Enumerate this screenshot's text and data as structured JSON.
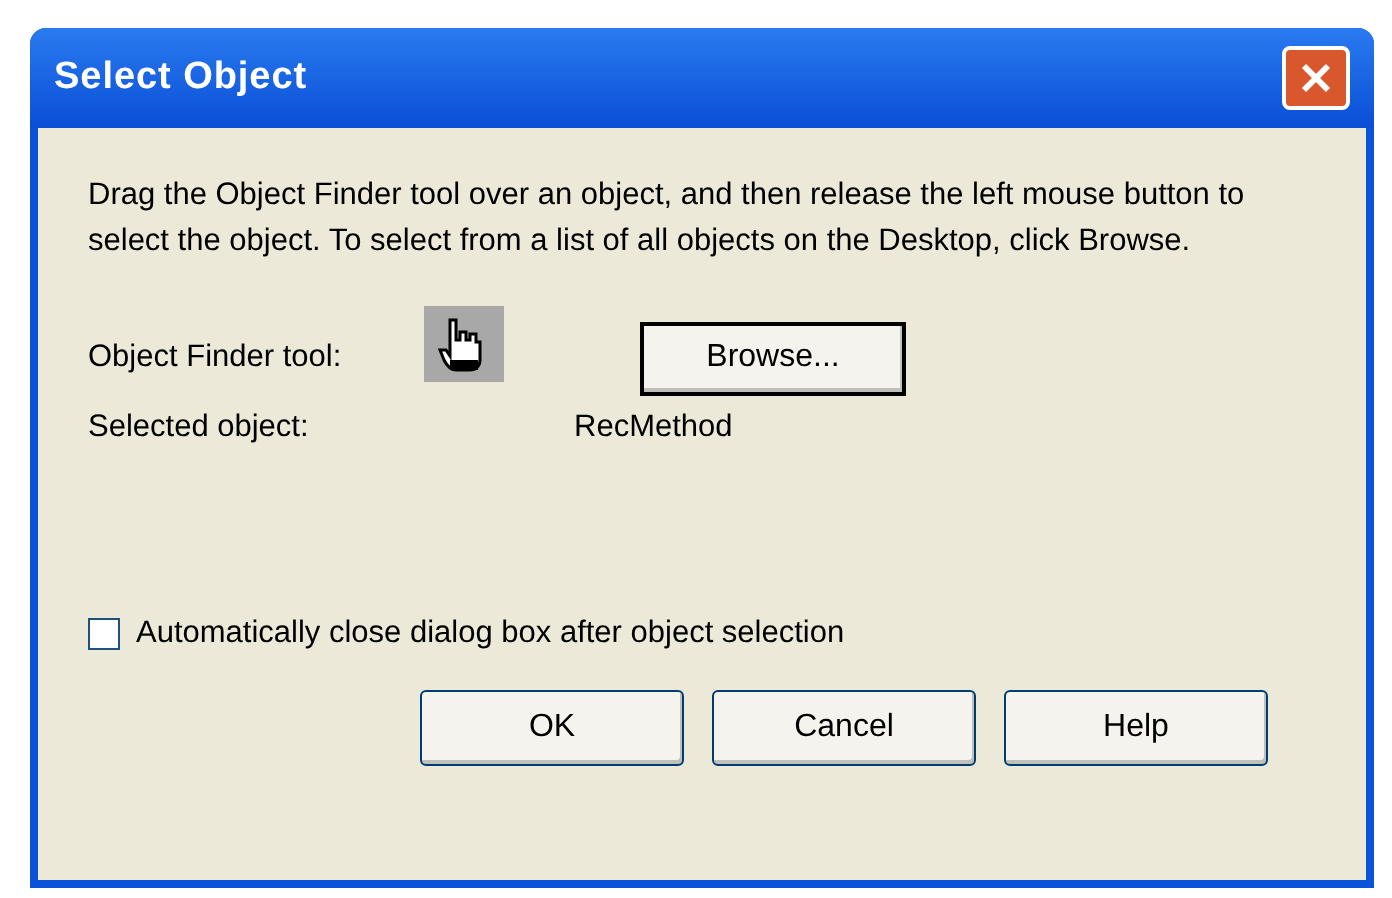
{
  "window": {
    "title": "Select Object"
  },
  "instructions": "Drag the Object Finder tool over an object, and then release the left mouse button to select the object.  To select from a list of all objects on the Desktop, click Browse.",
  "finder": {
    "label": "Object Finder tool:",
    "browse": "Browse..."
  },
  "selected": {
    "label": "Selected object:",
    "value": "RecMethod"
  },
  "auto_close": {
    "label": "Automatically close dialog box after object selection",
    "checked": false
  },
  "buttons": [
    "OK",
    "Cancel",
    "Help"
  ]
}
